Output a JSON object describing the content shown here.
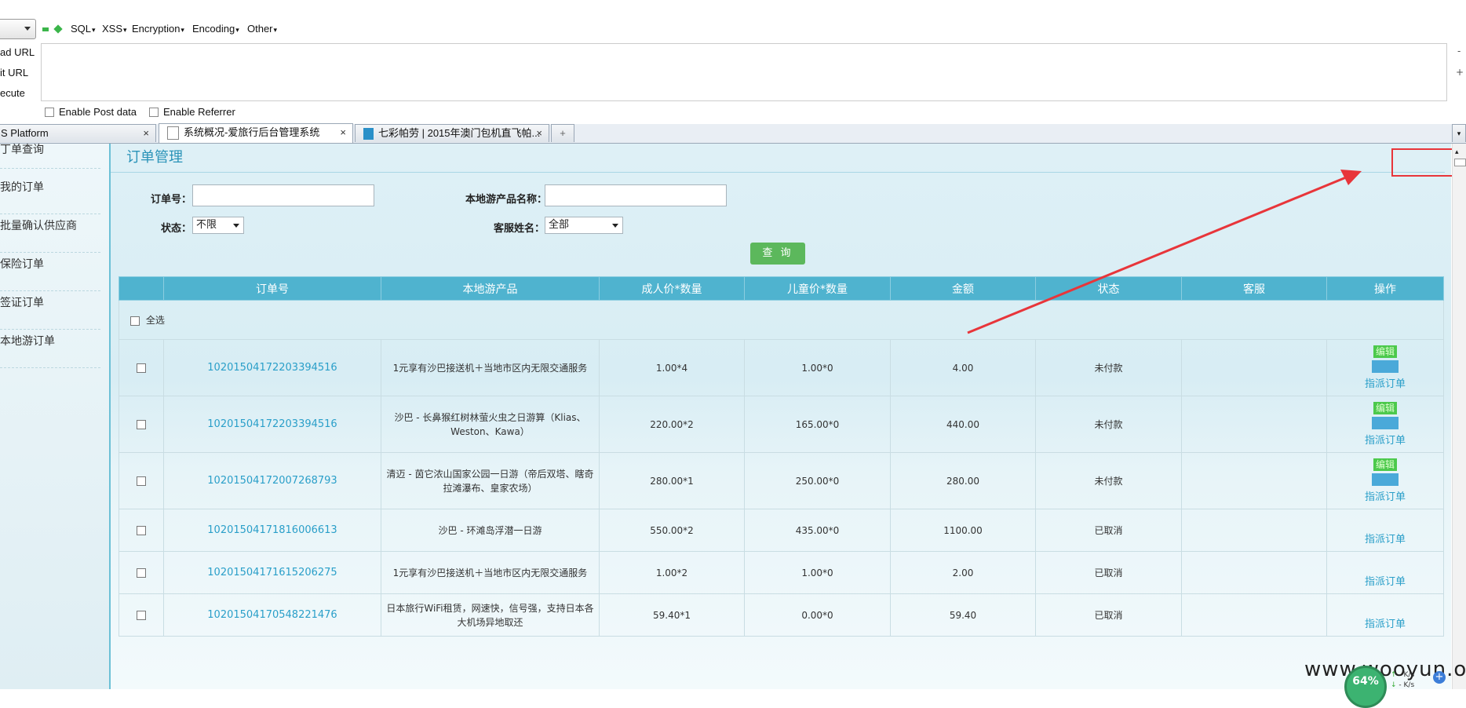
{
  "hackbar": {
    "menus": [
      "SQL",
      "XSS",
      "Encryption",
      "Encoding",
      "Other"
    ],
    "actions": [
      "ad URL",
      "it URL",
      "ecute"
    ],
    "url_value": "",
    "side_minus": "-",
    "side_plus": "+",
    "enable_post": "Enable Post data",
    "enable_referrer": "Enable Referrer"
  },
  "tabs": [
    {
      "title": "S Platform",
      "close": "×"
    },
    {
      "title": "系统概况-爱旅行后台管理系统",
      "close": "×"
    },
    {
      "title": "七彩帕劳 | 2015年澳门包机直飞帕...",
      "close": "×"
    }
  ],
  "new_tab": "+",
  "sidebar": {
    "items": [
      "丁单查询",
      "我的订单",
      "批量确认供应商",
      "保险订单",
      "签证订单",
      "本地游订单"
    ]
  },
  "page": {
    "title": "订单管理"
  },
  "filters": {
    "order_no_label": "订单号：",
    "order_no_value": "",
    "product_label": "本地游产品名称：",
    "product_value": "",
    "status_label": "状态：",
    "status_value": "不限",
    "cs_label": "客服姓名：",
    "cs_value": "全部",
    "query_button": "查 询"
  },
  "table": {
    "headers": [
      "",
      "订单号",
      "本地游产品",
      "成人价*数量",
      "儿童价*数量",
      "金额",
      "状态",
      "客服",
      "操作"
    ],
    "select_all": "全选",
    "edit_label": "编辑",
    "assign_label": "指派订单",
    "rows": [
      {
        "order_no": "10201504172203394516",
        "product": "1元享有沙巴接送机＋当地市区内无限交通服务",
        "adult": "1.00*4",
        "child": "1.00*0",
        "amount": "4.00",
        "status": "未付款",
        "cs": "",
        "editable": true
      },
      {
        "order_no": "10201504172203394516",
        "product": "沙巴 - 长鼻猴红树林萤火虫之日游算（Klias、Weston、Kawa）",
        "adult": "220.00*2",
        "child": "165.00*0",
        "amount": "440.00",
        "status": "未付款",
        "cs": "",
        "editable": true
      },
      {
        "order_no": "10201504172007268793",
        "product": "清迈 - 茵它浓山国家公园一日游（帝后双塔、瞎奇拉滩瀑布、皇家农场）",
        "adult": "280.00*1",
        "child": "250.00*0",
        "amount": "280.00",
        "status": "未付款",
        "cs": "",
        "editable": true
      },
      {
        "order_no": "10201504171816006613",
        "product": "沙巴 - 环滩岛浮潜一日游",
        "adult": "550.00*2",
        "child": "435.00*0",
        "amount": "1100.00",
        "status": "已取消",
        "cs": "",
        "editable": false
      },
      {
        "order_no": "10201504171615206275",
        "product": "1元享有沙巴接送机＋当地市区内无限交通服务",
        "adult": "1.00*2",
        "child": "1.00*0",
        "amount": "2.00",
        "status": "已取消",
        "cs": "",
        "editable": false
      },
      {
        "order_no": "10201504170548221476",
        "product": "日本旅行WiFi租赁，网速快，信号强，支持日本各大机场异地取还",
        "adult": "59.40*1",
        "child": "0.00*0",
        "amount": "59.40",
        "status": "已取消",
        "cs": "",
        "editable": false
      }
    ]
  },
  "watermark": "www.wooyun.org",
  "gauge": {
    "value": "64%",
    "up": "K/s",
    "down": "K/s"
  },
  "colors": {
    "accent": "#4fb3cf",
    "annotation": "#e8353a",
    "query_button": "#5cb85c"
  }
}
